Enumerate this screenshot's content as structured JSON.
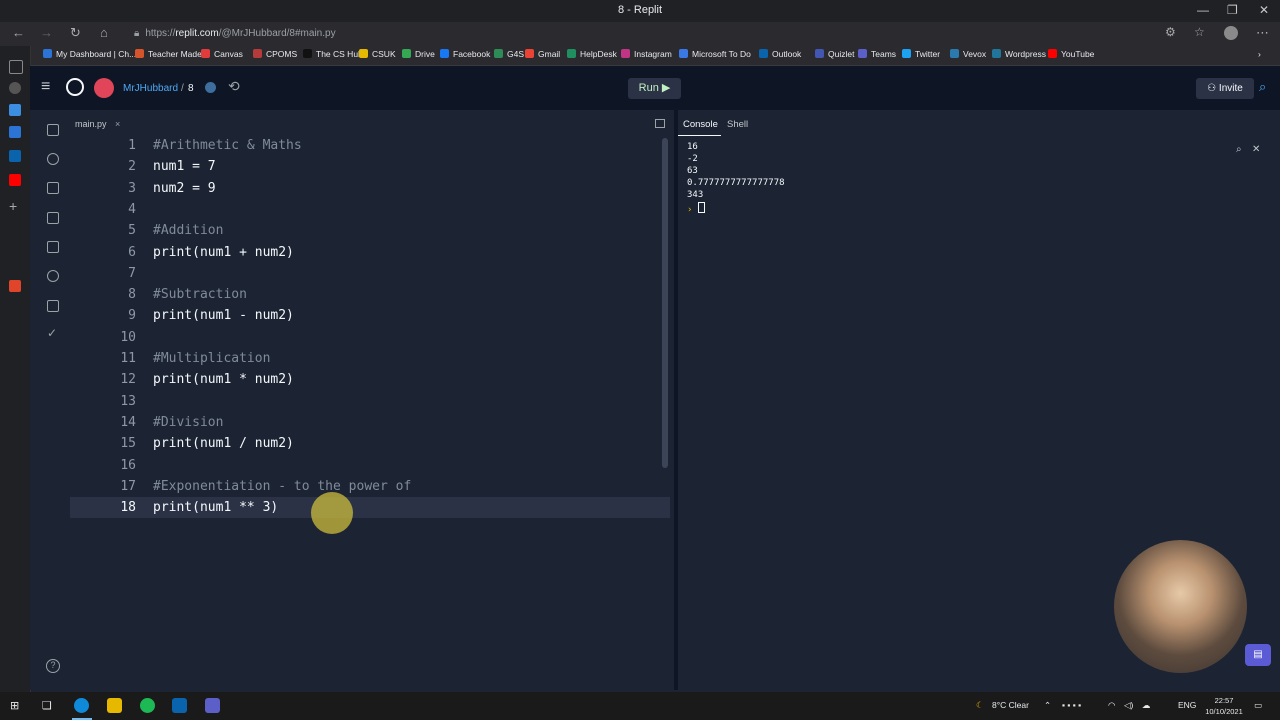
{
  "window": {
    "title": "8 - Replit",
    "minimize": "—",
    "restore": "❐",
    "close": "✕"
  },
  "browser": {
    "url_prefix": "https://",
    "url_host": "replit.com",
    "url_rest": "/@MrJHubbard/8#main.py",
    "bookmarks": [
      {
        "label": "My Dashboard | Ch...",
        "color": "#2b74d6"
      },
      {
        "label": "Teacher Made",
        "color": "#d6542b"
      },
      {
        "label": "Canvas",
        "color": "#e23b3b"
      },
      {
        "label": "CPOMS",
        "color": "#b53b3b"
      },
      {
        "label": "The CS Hub",
        "color": "#111111"
      },
      {
        "label": "CSUK",
        "color": "#e6b800"
      },
      {
        "label": "Drive",
        "color": "#34a853"
      },
      {
        "label": "Facebook",
        "color": "#1877f2"
      },
      {
        "label": "G4S",
        "color": "#2e8b57"
      },
      {
        "label": "Gmail",
        "color": "#ea4335"
      },
      {
        "label": "HelpDesk",
        "color": "#1f8f5f"
      },
      {
        "label": "Instagram",
        "color": "#c13584"
      },
      {
        "label": "Microsoft To Do",
        "color": "#3b78e7"
      },
      {
        "label": "Outlook",
        "color": "#0a64ad"
      },
      {
        "label": "Quizlet",
        "color": "#4257b2"
      },
      {
        "label": "Teams",
        "color": "#5b5fc7"
      },
      {
        "label": "Twitter",
        "color": "#1da1f2"
      },
      {
        "label": "Vevox",
        "color": "#2a7ab0"
      },
      {
        "label": "Wordpress",
        "color": "#21759b"
      },
      {
        "label": "YouTube",
        "color": "#ff0000"
      }
    ]
  },
  "replit": {
    "user": "MrJHubbard",
    "separator": "/",
    "repl": "8",
    "run_label": "Run ▶",
    "invite_label": "Invite"
  },
  "editor": {
    "file_tab": "main.py",
    "close_glyph": "×",
    "active_line": 18,
    "lines": [
      {
        "n": "1",
        "text": "#Arithmetic & Maths",
        "kind": "cmt"
      },
      {
        "n": "2",
        "text": "num1 = 7",
        "kind": "code"
      },
      {
        "n": "3",
        "text": "num2 = 9",
        "kind": "code"
      },
      {
        "n": "4",
        "text": "",
        "kind": "code"
      },
      {
        "n": "5",
        "text": "#Addition",
        "kind": "cmt"
      },
      {
        "n": "6",
        "text": "print(num1 + num2)",
        "kind": "code"
      },
      {
        "n": "7",
        "text": "",
        "kind": "code"
      },
      {
        "n": "8",
        "text": "#Subtraction",
        "kind": "cmt"
      },
      {
        "n": "9",
        "text": "print(num1 - num2)",
        "kind": "code"
      },
      {
        "n": "10",
        "text": "",
        "kind": "code"
      },
      {
        "n": "11",
        "text": "#Multiplication",
        "kind": "cmt"
      },
      {
        "n": "12",
        "text": "print(num1 * num2)",
        "kind": "code"
      },
      {
        "n": "13",
        "text": "",
        "kind": "code"
      },
      {
        "n": "14",
        "text": "#Division",
        "kind": "cmt"
      },
      {
        "n": "15",
        "text": "print(num1 / num2)",
        "kind": "code"
      },
      {
        "n": "16",
        "text": "",
        "kind": "code"
      },
      {
        "n": "17",
        "text": "#Exponentiation - to the power of",
        "kind": "cmt"
      },
      {
        "n": "18",
        "text": "print(num1 ** 3)",
        "kind": "code"
      }
    ]
  },
  "console": {
    "tabs": [
      "Console",
      "Shell"
    ],
    "output": [
      "16",
      "-2",
      "63",
      "0.7777777777777778",
      "343"
    ],
    "prompt": "›"
  },
  "taskbar": {
    "weather": "8°C  Clear",
    "lang": "ENG",
    "time": "22:57",
    "date": "10/10/2021"
  }
}
